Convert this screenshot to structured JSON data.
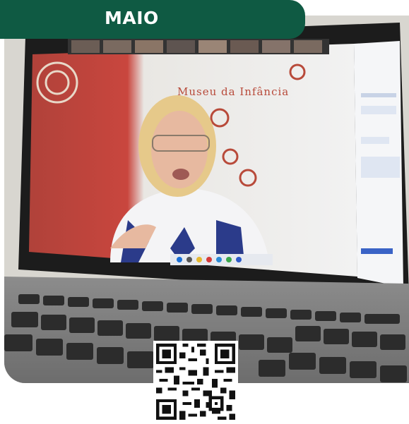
{
  "badge": {
    "label": "MAIO"
  },
  "scene": {
    "description_icon": "video-call-laptop-photo",
    "sign_text": "Museu da Infância"
  },
  "qr": {
    "icon": "qr-code-icon"
  },
  "colors": {
    "badge_bg": "#0f5a43",
    "badge_text": "#ffffff",
    "sign_text": "#b84a3a"
  }
}
